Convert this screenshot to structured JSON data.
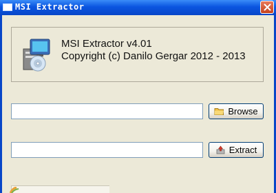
{
  "window": {
    "title": "MSI Extractor"
  },
  "info": {
    "line1": "MSI Extractor v4.01",
    "line2": "Copyright (c) Danilo Gergar 2012 - 2013"
  },
  "source_path": {
    "value": ""
  },
  "target_path": {
    "value": ""
  },
  "buttons": {
    "browse_label": "Browse",
    "extract_label": "Extract"
  },
  "icons": {
    "app": "installer-package-icon",
    "browse": "folder-icon",
    "extract": "extract-icon",
    "close": "close-icon"
  },
  "colors": {
    "titlebar": "#0a55e0",
    "close_button": "#d2532c",
    "window_background": "#ece9d8"
  }
}
